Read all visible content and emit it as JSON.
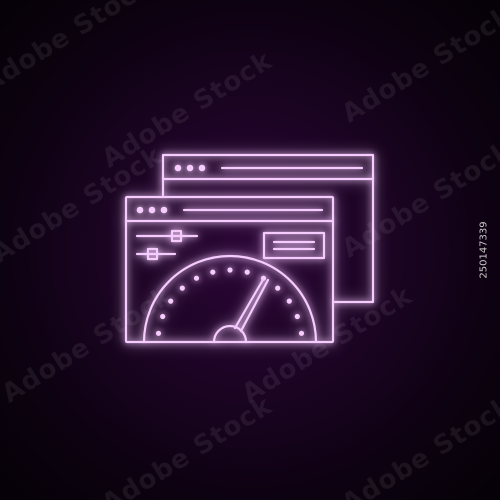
{
  "image": {
    "stock_id": "250147339",
    "watermark_text": "Adobe Stock"
  },
  "colors": {
    "background_center": "#2b0636",
    "background_edge": "#050107",
    "neon_stroke": "#f6ccff",
    "neon_glow": "#b530e0",
    "stock_id_text": "#c9c9c9"
  },
  "icon": {
    "name": "browser-speedometer-neon-icon",
    "parts": [
      "back-browser-window",
      "front-browser-window",
      "slider-controls",
      "text-box",
      "speedometer-gauge",
      "gauge-needle"
    ]
  }
}
